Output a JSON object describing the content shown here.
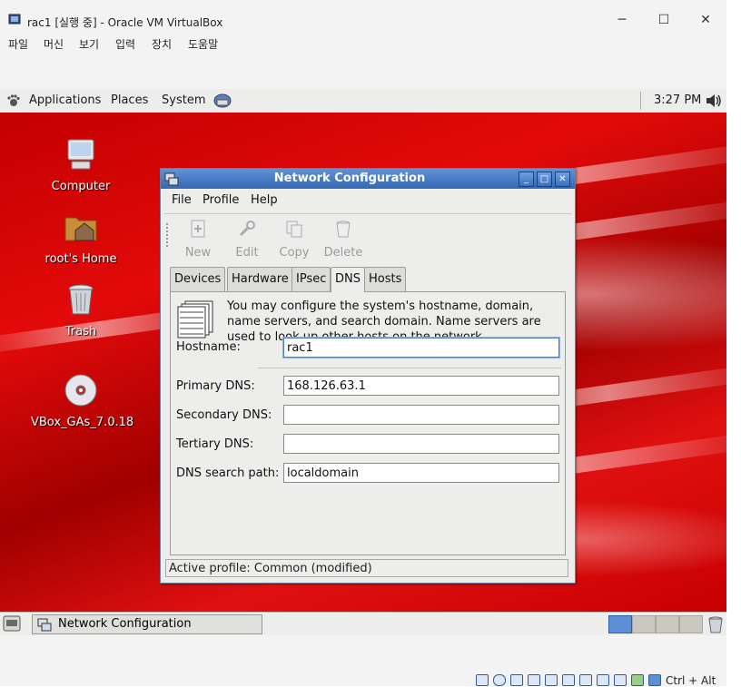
{
  "host_window": {
    "title": "rac1 [실행 중] - Oracle VM VirtualBox",
    "minimize": "─",
    "maximize": "☐",
    "close": "✕",
    "menu": [
      "파일",
      "머신",
      "보기",
      "입력",
      "장치",
      "도움말"
    ]
  },
  "guest_panel": {
    "applications": "Applications",
    "places": "Places",
    "system": "System",
    "clock": "3:27 PM"
  },
  "desktop_icons": [
    {
      "label": "Computer"
    },
    {
      "label": "root's Home"
    },
    {
      "label": "Trash"
    },
    {
      "label": "VBox_GAs_7.0.18"
    }
  ],
  "dialog": {
    "title": "Network Configuration",
    "menu": {
      "file": "File",
      "profile": "Profile",
      "help": "Help"
    },
    "toolbar": {
      "new": "New",
      "edit": "Edit",
      "copy": "Copy",
      "delete": "Delete"
    },
    "tabs": [
      "Devices",
      "Hardware",
      "IPsec",
      "DNS",
      "Hosts"
    ],
    "active_tab": "DNS",
    "description": "You may configure the system's hostname, domain, name servers, and search domain. Name servers are used to look up other hosts on the network.",
    "fields": {
      "hostname_label": "Hostname:",
      "hostname_value": "rac1",
      "primary_dns_label": "Primary DNS:",
      "primary_dns_value": "168.126.63.1",
      "secondary_dns_label": "Secondary DNS:",
      "secondary_dns_value": "",
      "tertiary_dns_label": "Tertiary DNS:",
      "tertiary_dns_value": "",
      "search_path_label": "DNS search path:",
      "search_path_value": "localdomain"
    },
    "status": "Active profile: Common (modified)"
  },
  "guest_bottom": {
    "task_label": "Network Configuration"
  },
  "host_status": {
    "hostkey": "Ctrl + Alt"
  },
  "colors": {
    "titlebar": "#3d70bd",
    "desktop_red": "#d40000",
    "panel": "#ededeb"
  }
}
